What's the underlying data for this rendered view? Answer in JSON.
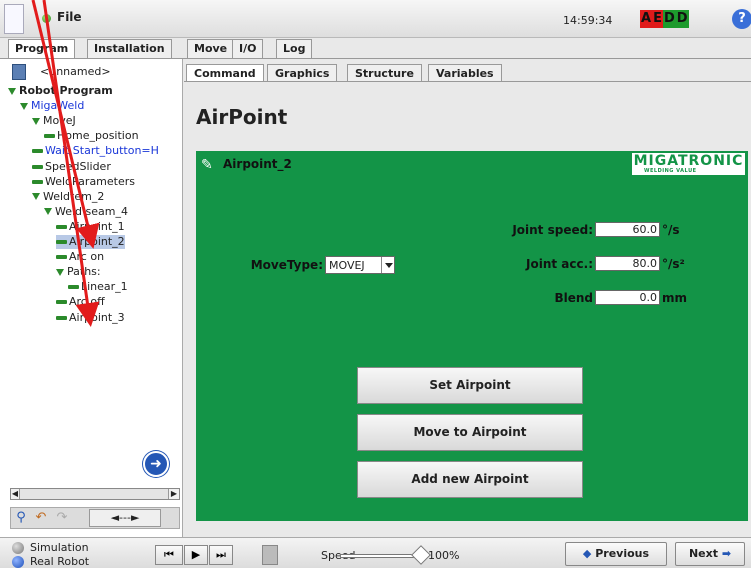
{
  "topbar": {
    "file_label": "File",
    "clock": "14:59:34",
    "status_letters": [
      {
        "ch": "A",
        "color": "#e01b1b"
      },
      {
        "ch": "E",
        "color": "#e01b1b"
      },
      {
        "ch": "D",
        "color": "#1d9b2d"
      },
      {
        "ch": "D",
        "color": "#1d9b2d"
      }
    ],
    "help_label": "?"
  },
  "main_tabs": [
    "Program",
    "Installation",
    "Move",
    "I/O",
    "Log"
  ],
  "left": {
    "program_name": "<unnamed>",
    "tree": [
      {
        "label": "Robot Program",
        "depth": 0,
        "type": "root"
      },
      {
        "label": "MigaWeld",
        "depth": 1,
        "type": "folder",
        "blue": true
      },
      {
        "label": "MoveJ",
        "depth": 2,
        "type": "folder"
      },
      {
        "label": "Home_position",
        "depth": 3,
        "type": "leaf"
      },
      {
        "label": "Wait Start_button=H",
        "depth": 2,
        "type": "leaf",
        "blue": true
      },
      {
        "label": "SpeedSlider",
        "depth": 2,
        "type": "leaf"
      },
      {
        "label": "WeldParameters",
        "depth": 2,
        "type": "leaf"
      },
      {
        "label": "Weldtem_2",
        "depth": 2,
        "type": "folder"
      },
      {
        "label": "Weld seam_4",
        "depth": 3,
        "type": "folder"
      },
      {
        "label": "Airpoint_1",
        "depth": 4,
        "type": "leaf"
      },
      {
        "label": "Airpoint_2",
        "depth": 4,
        "type": "leaf",
        "selected": true
      },
      {
        "label": "Arc on",
        "depth": 4,
        "type": "leaf"
      },
      {
        "label": "Paths:",
        "depth": 4,
        "type": "folder"
      },
      {
        "label": "Linear_1",
        "depth": 5,
        "type": "leaf"
      },
      {
        "label": "Arc off",
        "depth": 4,
        "type": "leaf"
      },
      {
        "label": "Airpoint_3",
        "depth": 4,
        "type": "leaf"
      }
    ],
    "arrow_tool_label": "◄---►"
  },
  "sub_tabs": [
    "Command",
    "Graphics",
    "Structure",
    "Variables"
  ],
  "content": {
    "title": "AirPoint",
    "airpoint_name": "Airpoint_2",
    "brand": "MIGATRONIC",
    "brand_sub": "WELDING VALUE",
    "movetype_label": "MoveType:",
    "movetype_value": "MOVEJ",
    "joint_speed_label": "Joint speed:",
    "joint_speed_value": "60.0",
    "joint_speed_unit": "°/s",
    "joint_acc_label": "Joint acc.:",
    "joint_acc_value": "80.0",
    "joint_acc_unit": "°/s²",
    "blend_label": "Blend",
    "blend_value": "0.0",
    "blend_unit": "mm",
    "set_airpoint": "Set Airpoint",
    "move_to_airpoint": "Move to Airpoint",
    "add_new_airpoint": "Add new Airpoint"
  },
  "bottom": {
    "simulation_label": "Simulation",
    "real_robot_label": "Real Robot",
    "speed_label": "Speed",
    "speed_value": "100%",
    "speed_level": 1.0,
    "previous_label": "Previous",
    "next_label": "Next"
  }
}
